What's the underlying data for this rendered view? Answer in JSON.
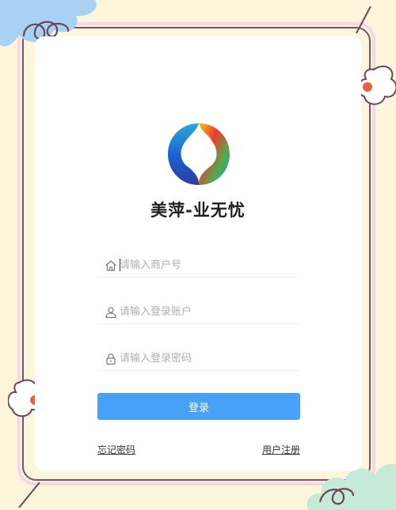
{
  "app": {
    "title": "美萍-业无忧"
  },
  "form": {
    "merchant_placeholder": "请输入商户号",
    "account_placeholder": "请输入登录账户",
    "password_placeholder": "请输入登录密码",
    "login_label": "登录"
  },
  "links": {
    "forgot": "忘记密码",
    "register": "用户注册"
  },
  "icons": {
    "merchant": "home-icon",
    "account": "user-icon",
    "password": "lock-icon"
  },
  "colors": {
    "background": "#fdf6dc",
    "card": "#ffffff",
    "login_button": "#47a1f7"
  }
}
